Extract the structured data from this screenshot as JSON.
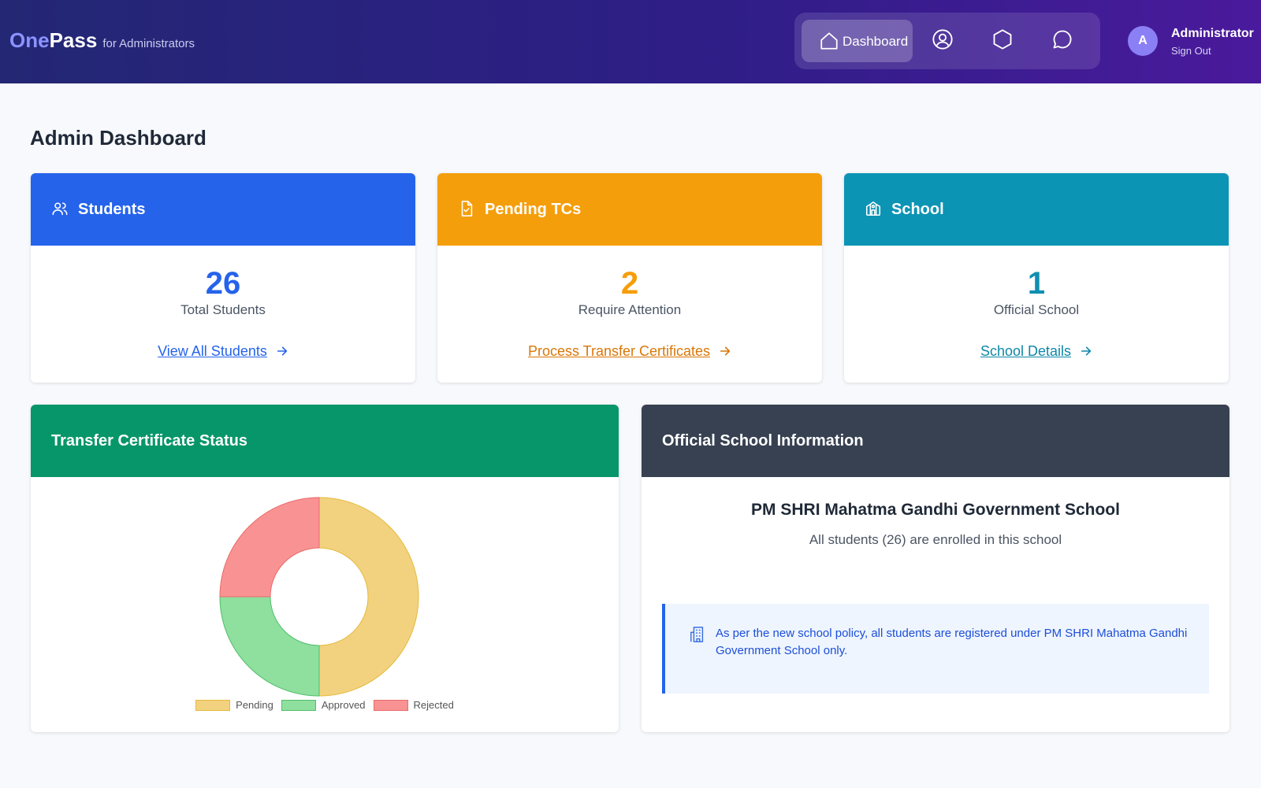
{
  "header": {
    "brand_one": "One",
    "brand_pass": "Pass",
    "brand_sub": "for Administrators",
    "nav": [
      {
        "label": "Dashboard",
        "icon": "home-icon",
        "active": true
      },
      {
        "label": "",
        "icon": "user-circle-icon"
      },
      {
        "label": "",
        "icon": "hexagon-icon"
      },
      {
        "label": "",
        "icon": "chat-bubble-icon"
      }
    ],
    "user": {
      "initial": "A",
      "name": "Administrator",
      "sign_out": "Sign Out"
    }
  },
  "page": {
    "title": "Admin Dashboard"
  },
  "stats": [
    {
      "title": "Students",
      "icon": "users-icon",
      "value": "26",
      "label": "Total Students",
      "link": "View All Students",
      "color": "#2563eb"
    },
    {
      "title": "Pending TCs",
      "icon": "document-check-icon",
      "value": "2",
      "label": "Require Attention",
      "link": "Process Transfer Certificates",
      "color": "#f59e0b"
    },
    {
      "title": "School",
      "icon": "school-icon",
      "value": "1",
      "label": "Official School",
      "link": "School Details",
      "color": "#0c94b5"
    }
  ],
  "tc_status": {
    "title": "Transfer Certificate Status"
  },
  "chart_data": {
    "type": "pie",
    "donut": true,
    "categories": [
      "Pending",
      "Approved",
      "Rejected"
    ],
    "values": [
      2,
      1,
      1
    ],
    "colors": [
      "#f2d27f",
      "#8fdf9f",
      "#f99393"
    ],
    "legend": "bottom"
  },
  "school_info": {
    "title": "Official School Information",
    "name": "PM SHRI Mahatma Gandhi Government School",
    "subtitle": "All students (26) are enrolled in this school",
    "notice": "As per the new school policy, all students are registered under PM SHRI Mahatma Gandhi Government School only."
  }
}
